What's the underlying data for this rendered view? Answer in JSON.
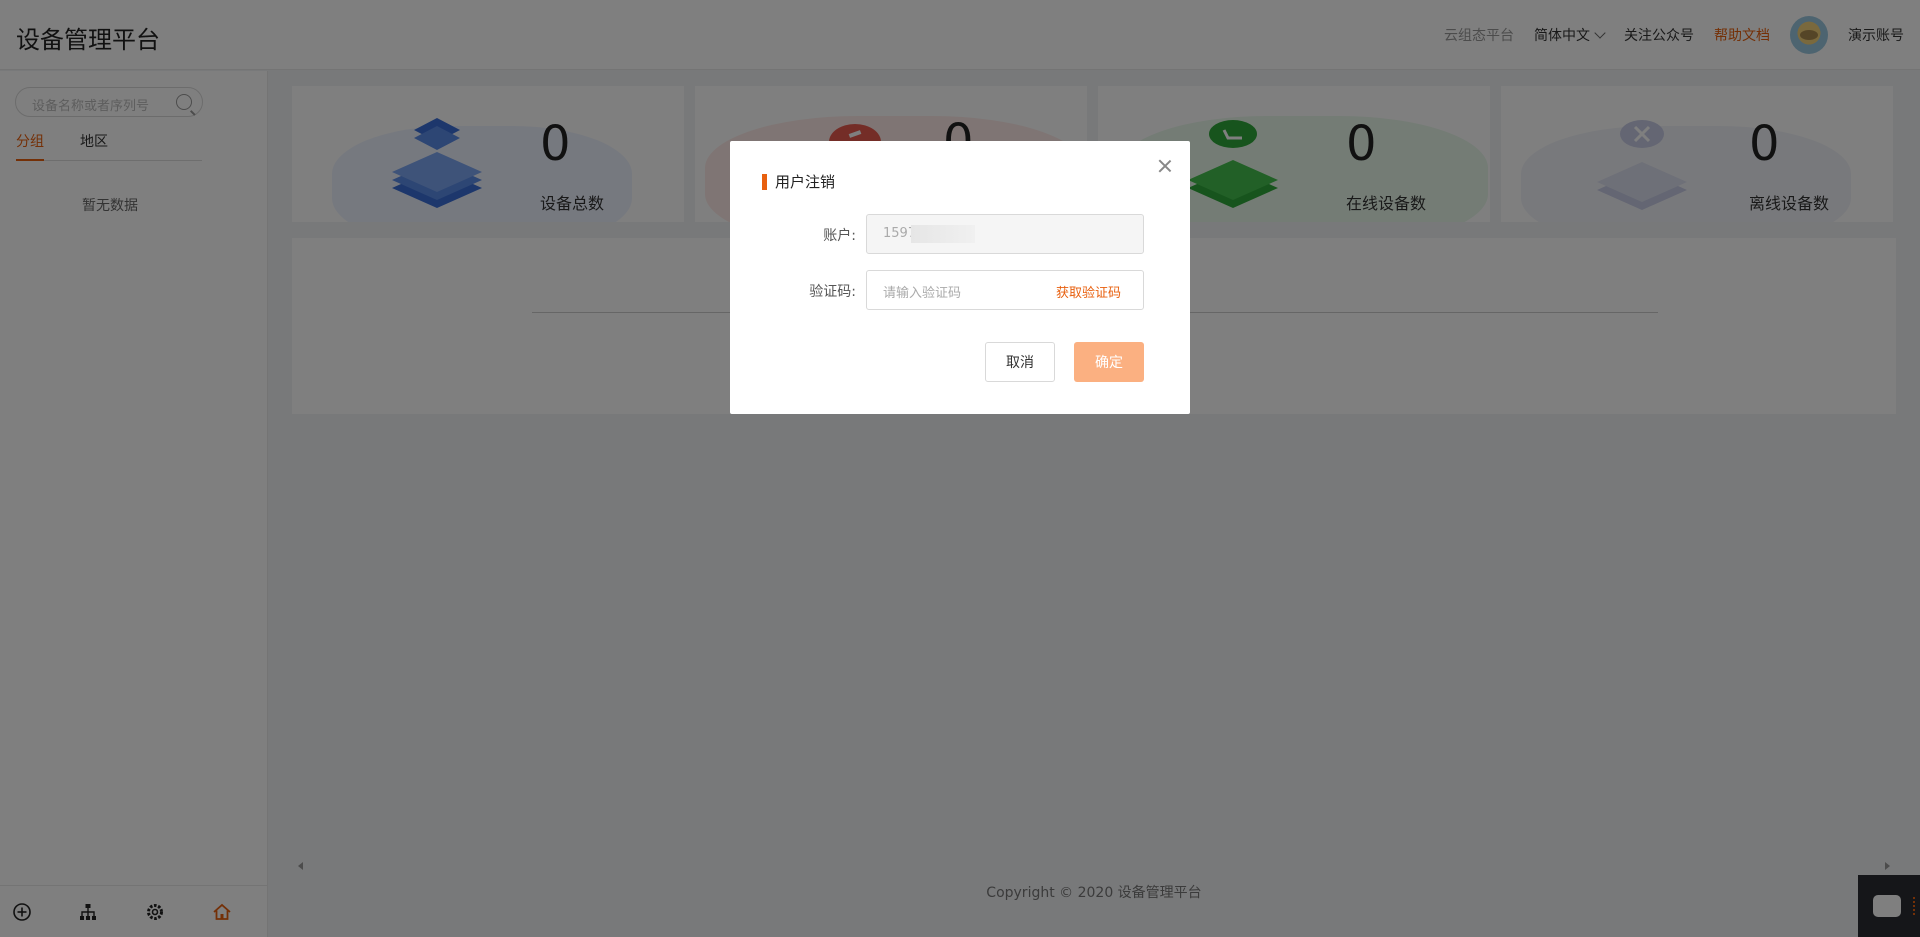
{
  "header": {
    "title": "设备管理平台",
    "links": {
      "cloud": "云组态平台",
      "language": "简体中文",
      "follow": "关注公众号",
      "help": "帮助文档",
      "account": "演示账号"
    }
  },
  "sidebar": {
    "search_placeholder": "设备名称或者序列号",
    "tabs": [
      "分组",
      "地区"
    ],
    "active_tab": "分组",
    "empty_text": "暂无数据",
    "bottom_icons": [
      "add-circle-icon",
      "hierarchy-icon",
      "settings-icon",
      "home-icon"
    ]
  },
  "stats": [
    {
      "value": "0",
      "label": "设备总数",
      "icon": "layers-icon",
      "color": "#3a6fd8"
    },
    {
      "value": "0",
      "label": "",
      "icon": "alarm-icon",
      "color": "#e85a4f"
    },
    {
      "value": "0",
      "label": "在线设备数",
      "icon": "online-icon",
      "color": "#2fa83a"
    },
    {
      "value": "0",
      "label": "离线设备数",
      "icon": "offline-icon",
      "color": "#c8cde6"
    }
  ],
  "footer": {
    "copyright": "Copyright © 2020 设备管理平台"
  },
  "modal": {
    "title": "用户注销",
    "account_label": "账户:",
    "account_value": "1597",
    "code_label": "验证码:",
    "code_placeholder": "请输入验证码",
    "get_code": "获取验证码",
    "cancel": "取消",
    "confirm": "确定"
  },
  "colors": {
    "accent": "#e8600f",
    "confirm_disabled": "#fbb081"
  }
}
